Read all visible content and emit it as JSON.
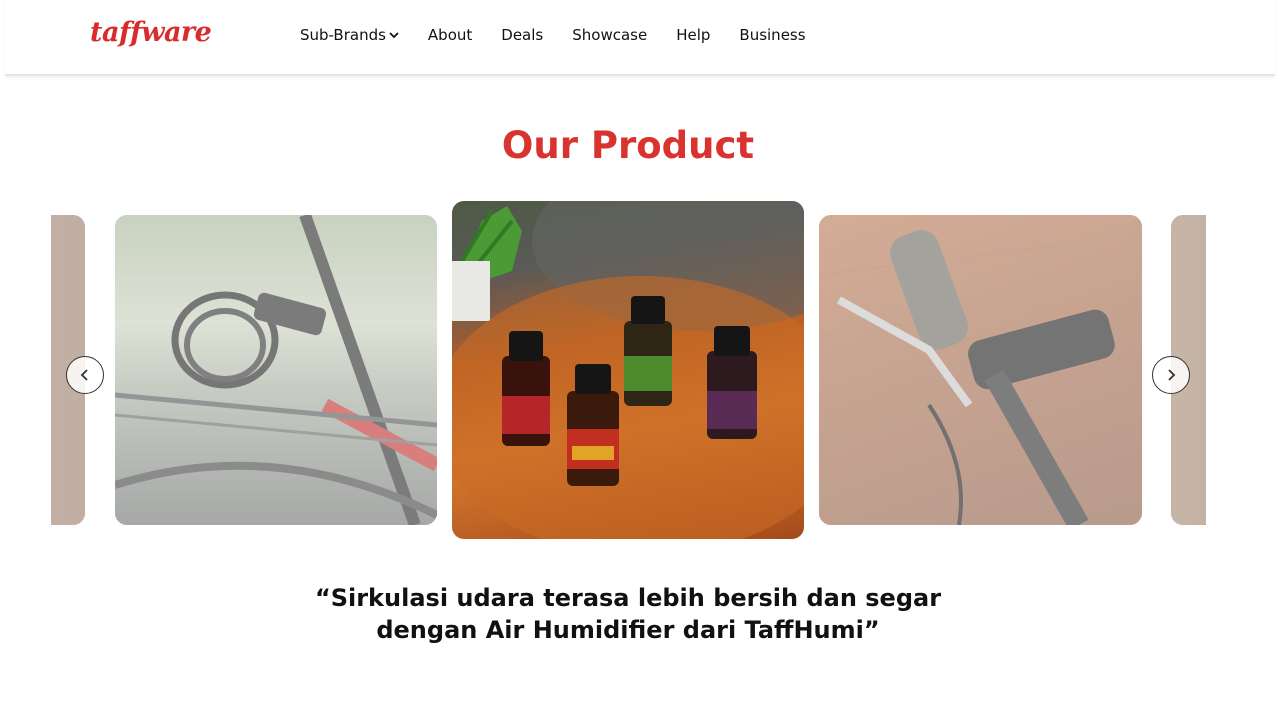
{
  "brand": {
    "logo_text": "taffware",
    "color": "#d92b2b"
  },
  "nav": {
    "items": [
      {
        "label": "Sub-Brands",
        "has_dropdown": true
      },
      {
        "label": "About"
      },
      {
        "label": "Deals"
      },
      {
        "label": "Showcase"
      },
      {
        "label": "Help"
      },
      {
        "label": "Business"
      }
    ]
  },
  "section": {
    "title": "Our Product",
    "title_color": "#d9322f"
  },
  "carousel": {
    "active_index": 2,
    "prev_icon": "chevron-left-icon",
    "next_icon": "chevron-right-icon"
  },
  "quote": {
    "line1": "“Sirkulasi udara terasa lebih bersih dan segar",
    "line2": "dengan Air Humidifier dari TaffHumi”"
  }
}
